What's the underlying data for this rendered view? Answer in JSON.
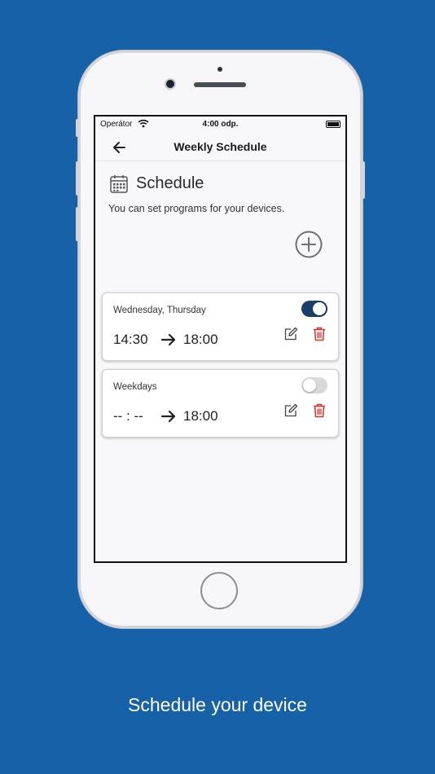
{
  "status_bar": {
    "carrier": "Operátor",
    "time": "4:00 odp."
  },
  "header": {
    "title": "Weekly Schedule",
    "back_icon": "arrow-left-icon"
  },
  "section": {
    "title": "Schedule",
    "subtitle": "You can set programs for your devices.",
    "icon": "calendar-icon",
    "add_icon": "plus-circle-icon"
  },
  "schedules": [
    {
      "days": "Wednesday, Thursday",
      "from": "14:30",
      "to": "18:00",
      "enabled": true
    },
    {
      "days": "Weekdays",
      "from": "-- : --",
      "to": "18:00",
      "enabled": false
    }
  ],
  "caption": "Schedule your device",
  "colors": {
    "background": "#1761a8",
    "toggle_on": "#17416b",
    "delete": "#d0322d",
    "caption": "#ffffff"
  }
}
